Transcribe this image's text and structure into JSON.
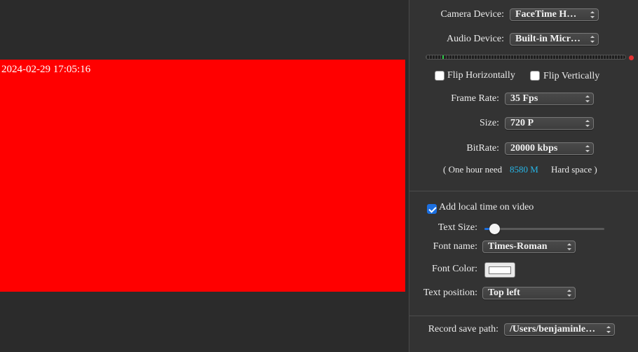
{
  "preview": {
    "timestamp": "2024-02-29 17:05:16",
    "background_color": "#ff0000"
  },
  "capture": {
    "camera_label": "Camera Device:",
    "camera_value": "FaceTime H…",
    "audio_label": "Audio Device:",
    "audio_value": "Built-in Micr…",
    "audio_level_fraction": 0.08,
    "flip_horizontal_label": "Flip Horizontally",
    "flip_horizontal_checked": false,
    "flip_vertical_label": "Flip Vertically",
    "flip_vertical_checked": false,
    "frame_rate_label": "Frame Rate:",
    "frame_rate_value": "35 Fps",
    "size_label": "Size:",
    "size_value": "720 P",
    "bitrate_label": "BitRate:",
    "bitrate_value": "20000 kbps",
    "storage_prefix": "( One hour need",
    "storage_amount": "8580 M",
    "storage_suffix": "Hard space )",
    "storage_amount_color": "#27b5e6"
  },
  "overlay": {
    "add_time_label": "Add local time on video",
    "add_time_checked": true,
    "text_size_label": "Text Size:",
    "text_size_fraction": 0.09,
    "font_name_label": "Font name:",
    "font_name_value": "Times-Roman",
    "font_color_label": "Font Color:",
    "font_color_value": "#ffffff",
    "text_position_label": "Text position:",
    "text_position_value": "Top left"
  },
  "save": {
    "path_label": "Record save path:",
    "path_value": "/Users/benjaminle…"
  },
  "colors": {
    "accent": "#1b6fe0",
    "panel_bg": "#333333"
  }
}
